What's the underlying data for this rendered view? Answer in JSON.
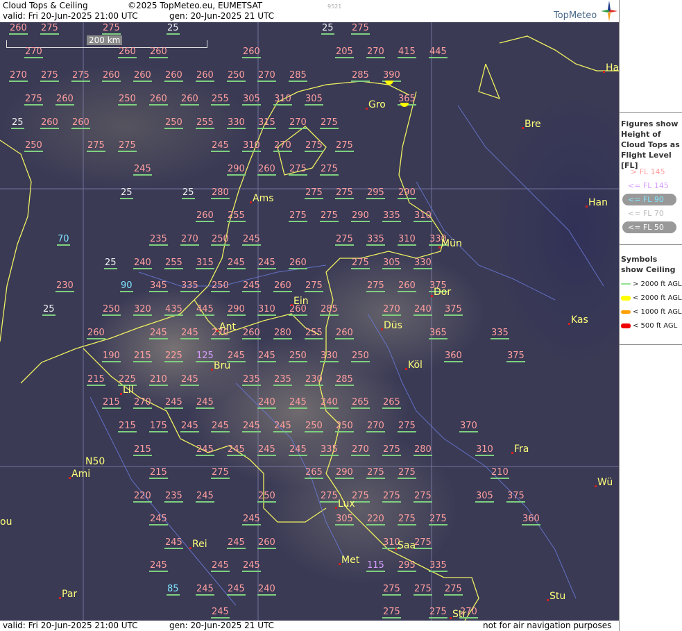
{
  "header": {
    "title": "Cloud Tops & Ceiling",
    "copyright": "©2025 TopMeteo.eu, EUMETSAT",
    "valid": "valid:  Fri  20-Jun-2025  21:00 UTC",
    "gen": "gen: 20-Jun-2025 21 UTC",
    "small_code": "9521",
    "logo": "TopMeteo"
  },
  "footer": {
    "valid": "valid:  Fri  20-Jun-2025  21:00 UTC",
    "gen": "gen: 20-Jun-2025 21 UTC",
    "disclaimer": "not for air navigation purposes"
  },
  "scale_bar": "200 km",
  "legend": {
    "figures_heading": "Figures show Height of Cloud Tops as Flight Level  [FL]",
    "fl_items": [
      {
        "text": "> FL 145",
        "color": "#ff9f9f"
      },
      {
        "text": "<= FL 145",
        "color": "#d79cff"
      },
      {
        "text": "<= FL 90",
        "color": "#7fe6ff"
      },
      {
        "text": "<= FL 70",
        "color": "#bbbbbb"
      },
      {
        "text": "<= FL 50",
        "color": "#ffffff"
      }
    ],
    "symbols_heading": "Symbols show Ceiling",
    "symbol_items": [
      {
        "text": "> 2000 ft AGL",
        "color": "#90e090"
      },
      {
        "text": "< 2000 ft AGL",
        "color": "#ffff00"
      },
      {
        "text": "< 1000 ft AGL",
        "color": "#ff9f00"
      },
      {
        "text": "< 500 ft AGL",
        "color": "#ee0000"
      }
    ]
  },
  "cities": [
    {
      "name": "Gro"
    },
    {
      "name": "Bre"
    },
    {
      "name": "Ha"
    },
    {
      "name": "Ams"
    },
    {
      "name": "Han"
    },
    {
      "name": "Mün"
    },
    {
      "name": "Dor"
    },
    {
      "name": "Ein"
    },
    {
      "name": "Kas"
    },
    {
      "name": "Ant"
    },
    {
      "name": "Düs"
    },
    {
      "name": "Bru"
    },
    {
      "name": "Köl"
    },
    {
      "name": "Lil"
    },
    {
      "name": "Fra"
    },
    {
      "name": "Ami"
    },
    {
      "name": "Wü"
    },
    {
      "name": "Lux"
    },
    {
      "name": "Rei"
    },
    {
      "name": "Saa"
    },
    {
      "name": "Met"
    },
    {
      "name": "Par"
    },
    {
      "name": "Stu"
    },
    {
      "name": "Str"
    },
    {
      "name": "ou"
    }
  ],
  "extra_labels": [
    {
      "text": "N50"
    }
  ],
  "cloud_tops": [
    "260",
    "275",
    "275",
    "25",
    "25",
    "275",
    "270",
    "260",
    "260",
    "260",
    "205",
    "270",
    "415",
    "445",
    "270",
    "275",
    "275",
    "260",
    "260",
    "260",
    "260",
    "250",
    "270",
    "285",
    "285",
    "390",
    "275",
    "260",
    "250",
    "260",
    "260",
    "255",
    "305",
    "310",
    "305",
    "365",
    "25",
    "260",
    "260",
    "250",
    "255",
    "330",
    "315",
    "270",
    "275",
    "250",
    "275",
    "275",
    "245",
    "310",
    "270",
    "275",
    "275",
    "245",
    "290",
    "260",
    "275",
    "275",
    "25",
    "25",
    "280",
    "275",
    "275",
    "295",
    "290",
    "260",
    "255",
    "275",
    "275",
    "290",
    "335",
    "310",
    "70",
    "235",
    "270",
    "250",
    "245",
    "275",
    "335",
    "310",
    "330",
    "25",
    "240",
    "255",
    "315",
    "245",
    "245",
    "260",
    "275",
    "305",
    "330",
    "230",
    "90",
    "345",
    "335",
    "250",
    "245",
    "260",
    "275",
    "275",
    "260",
    "375",
    "25",
    "250",
    "320",
    "435",
    "445",
    "290",
    "310",
    "260",
    "285",
    "270",
    "240",
    "375",
    "260",
    "245",
    "245",
    "270",
    "260",
    "280",
    "255",
    "260",
    "365",
    "335",
    "190",
    "215",
    "225",
    "125",
    "245",
    "245",
    "250",
    "330",
    "250",
    "360",
    "375",
    "215",
    "225",
    "210",
    "245",
    "235",
    "235",
    "230",
    "285",
    "215",
    "270",
    "245",
    "245",
    "240",
    "245",
    "240",
    "265",
    "265",
    "215",
    "175",
    "245",
    "245",
    "245",
    "245",
    "250",
    "250",
    "270",
    "275",
    "370",
    "215",
    "245",
    "245",
    "245",
    "245",
    "335",
    "270",
    "275",
    "280",
    "310",
    "215",
    "275",
    "265",
    "290",
    "275",
    "275",
    "210",
    "220",
    "235",
    "245",
    "250",
    "275",
    "275",
    "275",
    "275",
    "305",
    "375",
    "245",
    "245",
    "305",
    "220",
    "275",
    "275",
    "360",
    "245",
    "245",
    "260",
    "310",
    "275",
    "245",
    "245",
    "245",
    "115",
    "295",
    "335",
    "85",
    "245",
    "245",
    "240",
    "275",
    "275",
    "275",
    "245",
    "275",
    "275",
    "270"
  ]
}
